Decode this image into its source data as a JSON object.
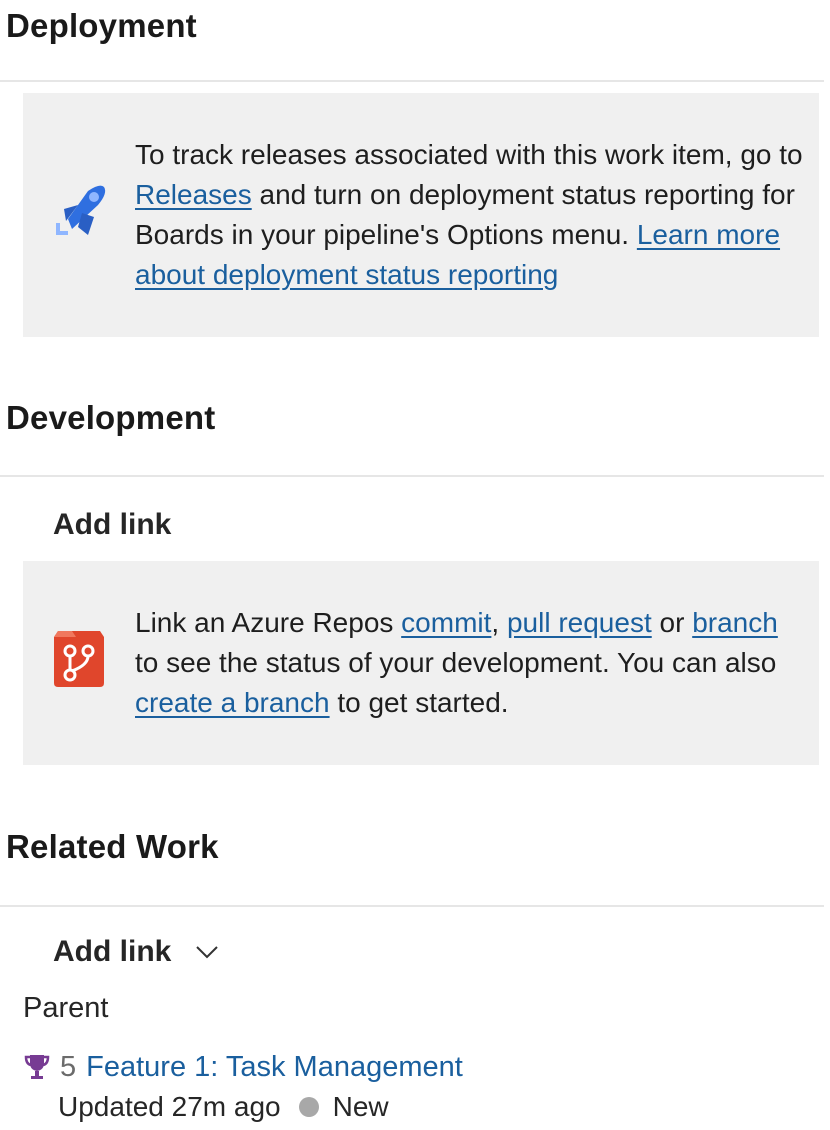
{
  "deployment": {
    "title": "Deployment",
    "message": {
      "part1": "To track releases associated with this work item, go to ",
      "releases_link": "Releases",
      "part2": " and turn on deployment status reporting for Boards in your pipeline's Options menu. ",
      "learn_more_link": "Learn more about deployment status reporting"
    },
    "icon": "pipelines-rocket-icon",
    "icon_color": "#2f6fe0"
  },
  "development": {
    "title": "Development",
    "add_link_label": "Add link",
    "message": {
      "part1": "Link an Azure Repos ",
      "commit_link": "commit",
      "sep1": ", ",
      "pull_request_link": "pull request",
      "part2": " or ",
      "branch_link": "branch",
      "part3": " to see the status of your development. You can also ",
      "create_branch_link": "create a branch",
      "part4": " to get started."
    },
    "icon": "repos-branch-icon",
    "icon_color": "#e0462c"
  },
  "related_work": {
    "title": "Related Work",
    "add_link_label": "Add link",
    "group_label": "Parent",
    "items": [
      {
        "id": "5",
        "title": "Feature 1: Task Management",
        "updated": "Updated 27m ago",
        "state": "New",
        "state_color": "#a8a8a8",
        "type_icon": "trophy-icon",
        "type_color": "#773b93"
      }
    ]
  },
  "colors": {
    "link": "#1a5f9e",
    "info_bg": "#f0f0f0",
    "divider": "#e6e6e6"
  }
}
